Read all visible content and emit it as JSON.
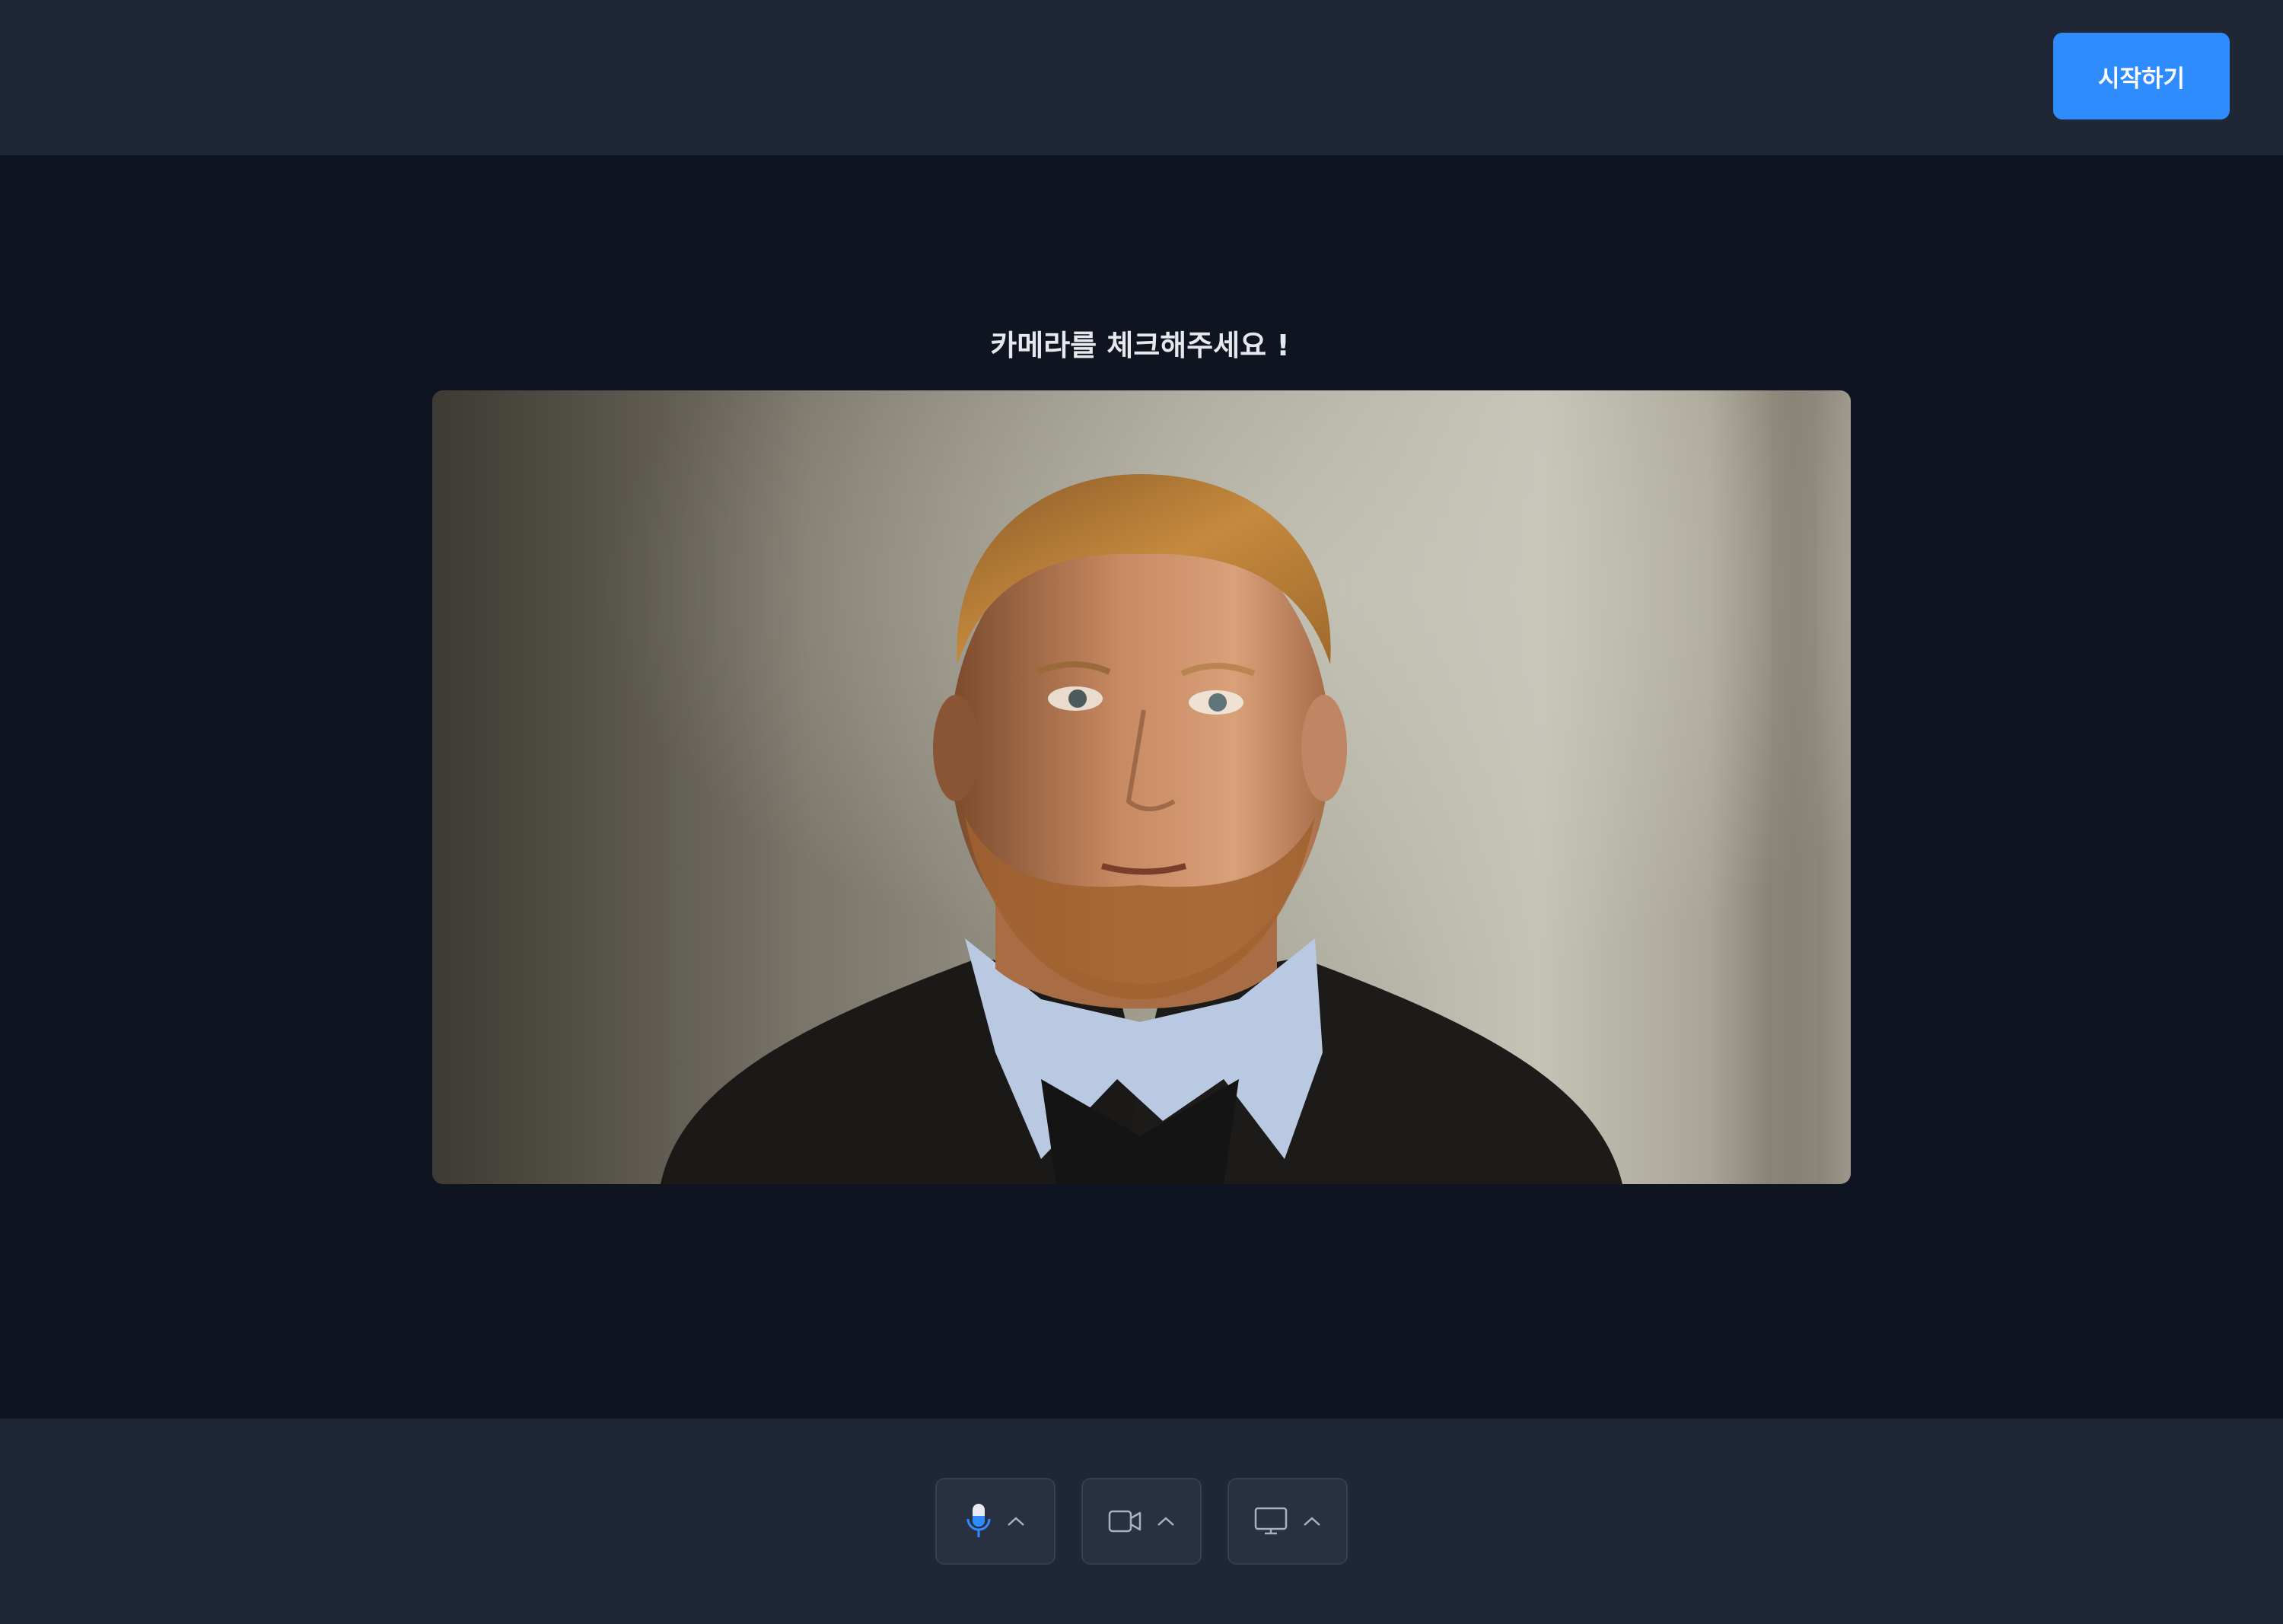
{
  "header": {
    "start_button_label": "시작하기"
  },
  "main": {
    "title": "카메라를 체크해주세요 !",
    "preview": {
      "subject": "camera-preview-person"
    }
  },
  "controls": [
    {
      "name": "microphone",
      "icon": "microphone-icon",
      "active": true,
      "color": "#2f8cff"
    },
    {
      "name": "camera",
      "icon": "video-camera-icon",
      "active": false,
      "color": "#aab1bd"
    },
    {
      "name": "screen-share",
      "icon": "monitor-icon",
      "active": false,
      "color": "#aab1bd"
    }
  ],
  "colors": {
    "accent": "#2f8cff",
    "bar_background": "#1f2737",
    "page_background": "#0e1420"
  }
}
